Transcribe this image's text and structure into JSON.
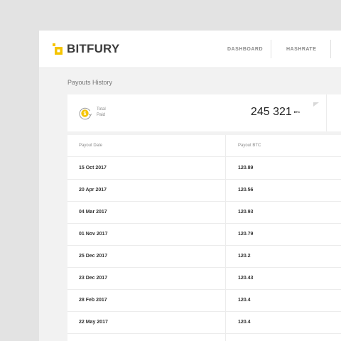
{
  "brand": {
    "name": "BITFURY",
    "accent": "#f5c400"
  },
  "nav": {
    "items": [
      "DASHBOARD",
      "HASHRATE"
    ]
  },
  "page": {
    "section_title": "Payouts History"
  },
  "summary": {
    "label_line1": "Total",
    "label_line2": "Paid",
    "value": "245 321",
    "unit": "BTC",
    "icon": "coin-arrow-icon"
  },
  "table": {
    "columns": [
      "Payout Date",
      "Payout BTC"
    ],
    "rows": [
      [
        "15 Oct 2017",
        "120.89"
      ],
      [
        "20 Apr 2017",
        "120.56"
      ],
      [
        "04 Mar 2017",
        "120.93"
      ],
      [
        "01 Nov 2017",
        "120.79"
      ],
      [
        "25 Dec 2017",
        "120.2"
      ],
      [
        "23 Dec 2017",
        "120.43"
      ],
      [
        "28 Feb 2017",
        "120.4"
      ],
      [
        "22 May 2017",
        "120.4"
      ]
    ]
  }
}
